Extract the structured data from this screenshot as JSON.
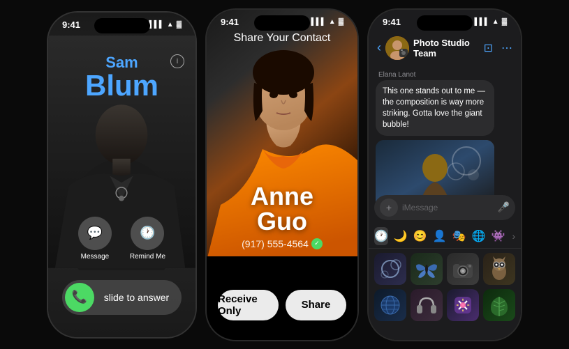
{
  "background": "#0a0a0a",
  "phone1": {
    "time": "9:41",
    "caller": {
      "first_name": "Sam",
      "last_name": "Blum"
    },
    "actions": {
      "message": "Message",
      "remind": "Remind Me"
    },
    "slide_text": "slide to answer"
  },
  "phone2": {
    "time": "9:41",
    "share_title": "Share Your Contact",
    "contact": {
      "first_name": "Anne",
      "last_name": "Guo",
      "phone": "(917) 555-4564"
    },
    "buttons": {
      "receive_only": "Receive Only",
      "share": "Share"
    }
  },
  "phone3": {
    "time": "9:41",
    "group_name": "Photo Studio Team",
    "message": {
      "sender": "Elana Lanot",
      "text": "This one stands out to me — the composition is way more striking. Gotta love the giant bubble!"
    },
    "input_placeholder": "iMessage",
    "sticker_tabs": [
      "🕐",
      "🌙",
      "😊",
      "👤",
      "🎭",
      "🌐",
      "👽"
    ],
    "stickers": [
      "bubbles",
      "butterfly",
      "camera",
      "owl",
      "globe",
      "headphones",
      "art",
      "leaf"
    ]
  }
}
